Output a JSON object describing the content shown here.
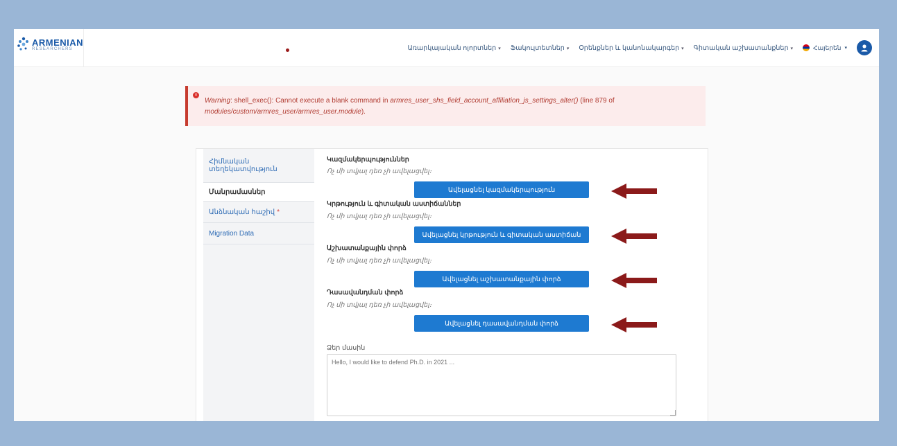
{
  "brand": {
    "name": "ARMENIAN",
    "sub": "RESEARCHERS"
  },
  "nav": {
    "items": [
      {
        "label": "Առարկայական ոլորտներ"
      },
      {
        "label": "Ֆակուլտետներ"
      },
      {
        "label": "Օրենքներ և կանոնակարգեր"
      },
      {
        "label": "Գիտական աշխատանքներ"
      }
    ],
    "language": "Հայերեն"
  },
  "warning": {
    "prefix": "Warning",
    "message": ": shell_exec(): Cannot execute a blank command in ",
    "function": "armres_user_shs_field_account_affiliation_js_settings_alter()",
    "line": " (line 879 of",
    "file": "modules/custom/armres_user/armres_user.module",
    "suffix": ")."
  },
  "tabs": [
    {
      "label": "Հիմնական տեղեկատվություն",
      "active": false,
      "required": false
    },
    {
      "label": "Մանրամասներ",
      "active": true,
      "required": false
    },
    {
      "label": "Անձնական հաշիվ",
      "active": false,
      "required": true
    },
    {
      "label": "Migration Data",
      "active": false,
      "required": false
    }
  ],
  "sections": [
    {
      "title": "Կազմակերպություններ",
      "empty": "Ոչ մի տվյալ դեռ չի ավելացվել։",
      "button": "Ավելացնել կազմակերպություն"
    },
    {
      "title": "Կրթություն և գիտական աստիճաններ",
      "empty": "Ոչ մի տվյալ դեռ չի ավելացվել։",
      "button": "Ավելացնել կրթություն և գիտական աստիճան"
    },
    {
      "title": "Աշխատանքային փորձ",
      "empty": "Ոչ մի տվյալ դեռ չի ավելացվել։",
      "button": "Ավելացնել աշխատանքային փորձ"
    },
    {
      "title": "Դասավանդման փորձ",
      "empty": "Ոչ մի տվյալ դեռ չի ավելացվել։",
      "button": "Ավելացնել դասավանդման փորձ"
    }
  ],
  "message": {
    "label": "Ձեր մասին",
    "placeholder": "Hello, I would like to defend Ph.D. in 2021 ..."
  },
  "colors": {
    "accent": "#1e7ad1",
    "arrow": "#8b1a1a",
    "warning": "#c63b2e"
  }
}
